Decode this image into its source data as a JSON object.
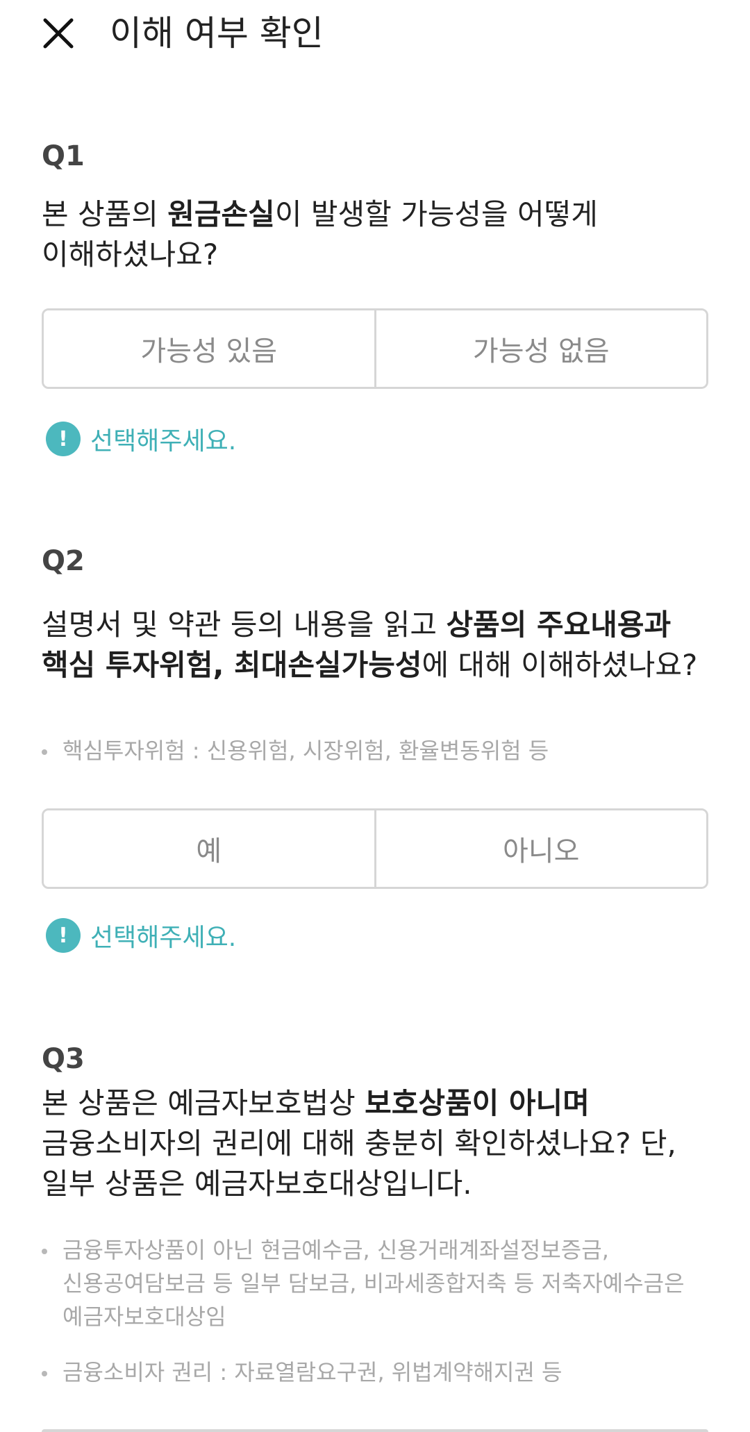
{
  "header": {
    "title": "이해 여부 확인",
    "close_icon": "close-icon"
  },
  "q1": {
    "label": "Q1",
    "text_before": "본 상품의 ",
    "text_bold": "원금손실",
    "text_after": "이 발생할 가능성을 어떻게 이해하셨나요?",
    "options": [
      "가능성 있음",
      "가능성 없음"
    ],
    "warning": "선택해주세요."
  },
  "q2": {
    "label": "Q2",
    "text_before": "설명서 및 약관 등의 내용을 읽고 ",
    "text_bold": "상품의 주요내용과 핵심 투자위험, 최대손실가능성",
    "text_after": "에 대해 이해하셨나요?",
    "note": "핵심투자위험 : 신용위험, 시장위험, 환율변동위험 등",
    "options": [
      "예",
      "아니오"
    ],
    "warning": "선택해주세요."
  },
  "q3": {
    "label": "Q3",
    "text_before": "본 상품은 예금자보호법상 ",
    "text_bold": "보호상품이 아니며",
    "text_after": " 금융소비자의 권리에 대해 충분히 확인하셨나요? 단, 일부 상품은 예금자보호대상입니다.",
    "notes": [
      "금융투자상품이 아닌 현금예수금, 신용거래계좌설정보증금, 신용공여담보금 등 일부 담보금, 비과세종합저축 등 저축자예수금은 예금자보호대상임",
      "금융소비자 권리 : 자료열람요구권, 위법계약해지권 등"
    ]
  },
  "colors": {
    "accent": "#4cb8be",
    "border": "#d6d6d6",
    "muted_text": "#a8a8a8"
  }
}
